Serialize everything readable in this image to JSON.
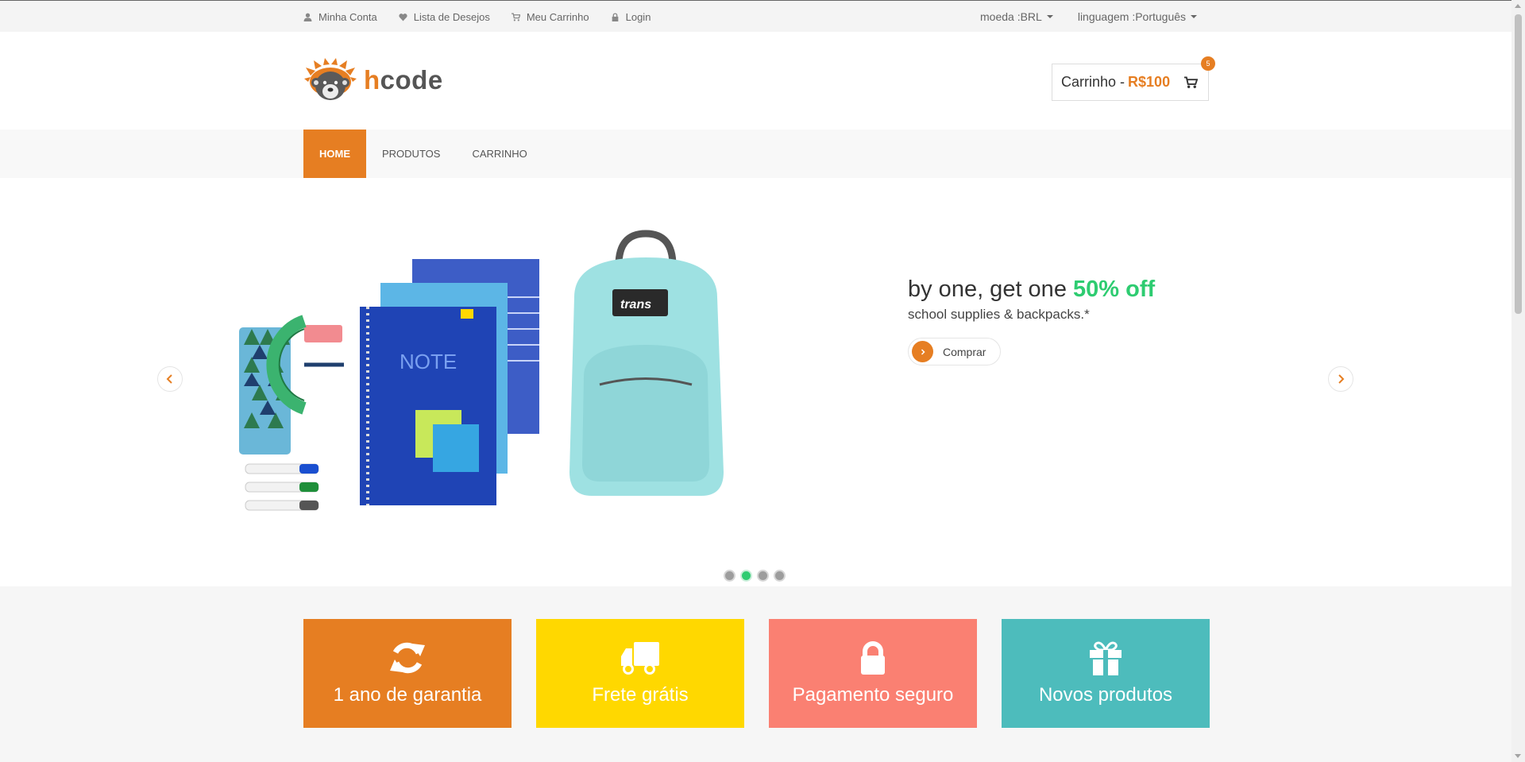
{
  "topbar": {
    "links": [
      {
        "label": "Minha Conta",
        "icon": "user-icon"
      },
      {
        "label": "Lista de Desejos",
        "icon": "heart-icon"
      },
      {
        "label": "Meu Carrinho",
        "icon": "cart-icon"
      },
      {
        "label": "Login",
        "icon": "lock-icon"
      }
    ],
    "currency": "moeda :BRL",
    "language": "linguagem :Português"
  },
  "logo": {
    "text_h": "h",
    "text_rest": "code"
  },
  "cart": {
    "label": "Carrinho -",
    "amount": "R$100",
    "badge": "5"
  },
  "nav": {
    "items": [
      "HOME",
      "PRODUTOS",
      "CARRINHO"
    ],
    "active": "HOME"
  },
  "slider": {
    "headline": "by one, get one ",
    "highlight": "50% off",
    "subline": "school supplies & backpacks.*",
    "button": "Comprar",
    "dots_count": 4,
    "active_dot": 2
  },
  "promos": [
    {
      "label": "1 ano de garantia",
      "icon": "refresh-icon",
      "color": "#e67e22"
    },
    {
      "label": "Frete grátis",
      "icon": "truck-icon",
      "color": "#ffd800"
    },
    {
      "label": "Pagamento seguro",
      "icon": "lock-icon",
      "color": "#fa8072"
    },
    {
      "label": "Novos produtos",
      "icon": "gift-icon",
      "color": "#4dbcbc"
    }
  ],
  "colors": {
    "accent": "#e67e22",
    "offer": "#2ecc71"
  }
}
